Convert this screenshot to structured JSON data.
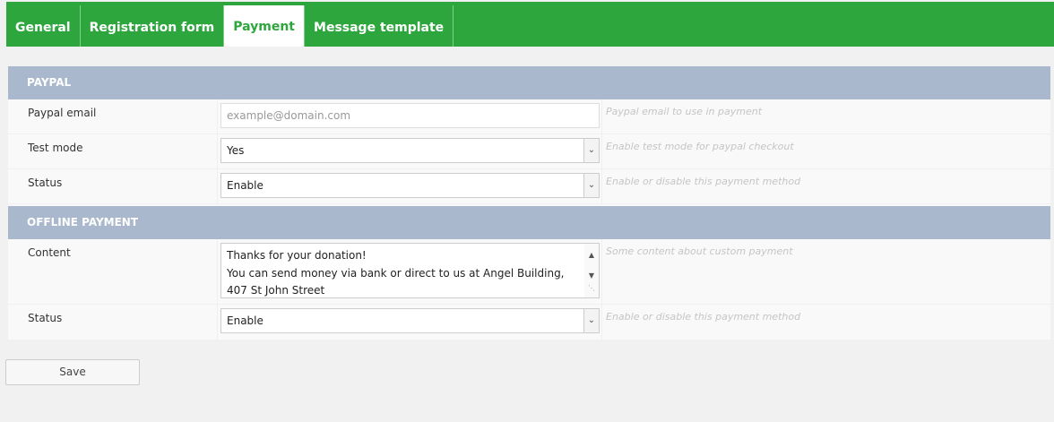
{
  "tabs": [
    {
      "label": "General"
    },
    {
      "label": "Registration form"
    },
    {
      "label": "Payment"
    },
    {
      "label": "Message template"
    }
  ],
  "paypal": {
    "heading": "PAYPAL",
    "email": {
      "label": "Paypal email",
      "placeholder": "example@domain.com",
      "hint": "Paypal email to use in payment"
    },
    "test_mode": {
      "label": "Test mode",
      "value": "Yes",
      "hint": "Enable test mode for paypal checkout"
    },
    "status": {
      "label": "Status",
      "value": "Enable",
      "hint": "Enable or disable this payment method"
    }
  },
  "offline": {
    "heading": "OFFLINE PAYMENT",
    "content": {
      "label": "Content",
      "lines": [
        "Thanks for your donation!",
        "You can send money via bank or direct to us at Angel Building,",
        "407 St John Street"
      ],
      "hint": "Some content about custom payment"
    },
    "status": {
      "label": "Status",
      "value": "Enable",
      "hint": "Enable or disable this payment method"
    }
  },
  "save_label": "Save",
  "colors": {
    "accent": "#2ea63e",
    "section": "#a9b8cc"
  }
}
